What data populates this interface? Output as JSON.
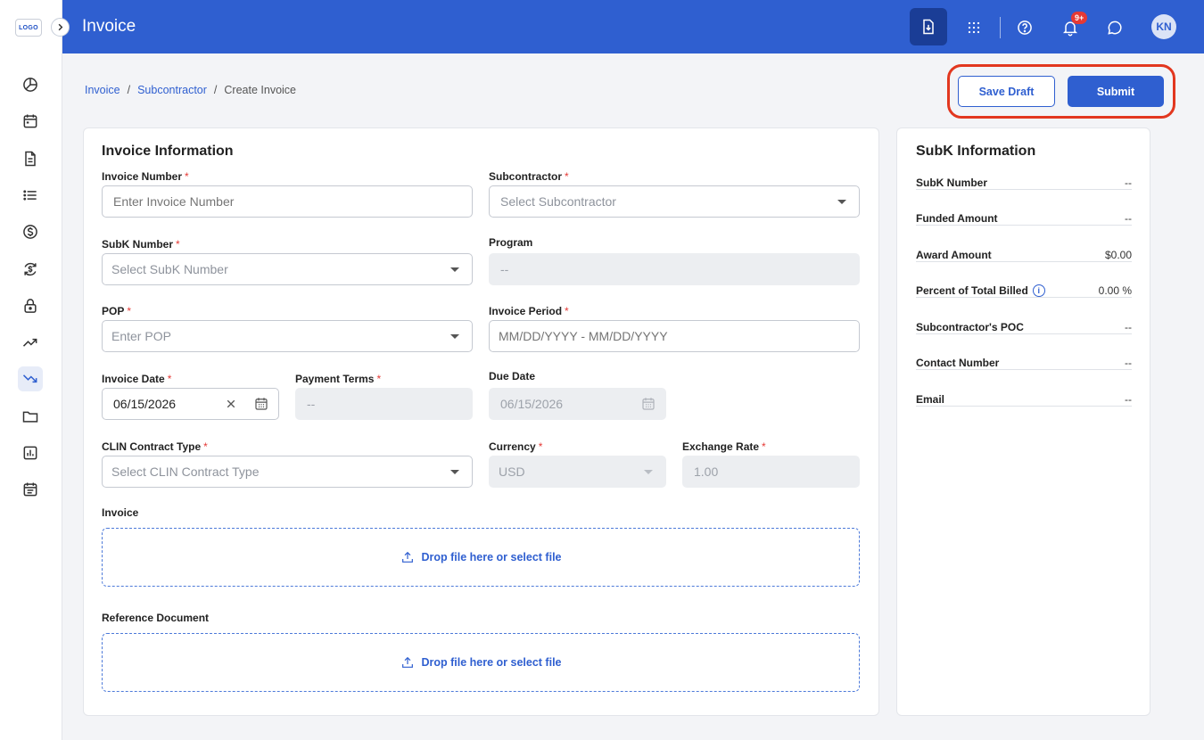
{
  "app": {
    "logo_text": "LOGO",
    "title": "Invoice",
    "notification_count": "9+",
    "avatar_initials": "KN"
  },
  "colors": {
    "primary": "#2f5fd0",
    "primary_dark": "#1a3d96",
    "required": "#e53935",
    "highlight_ring": "#e2371f"
  },
  "sidebar": {
    "items": [
      {
        "icon": "pie-chart-icon"
      },
      {
        "icon": "calendar-icon"
      },
      {
        "icon": "document-icon"
      },
      {
        "icon": "list-icon"
      },
      {
        "icon": "dollar-icon"
      },
      {
        "icon": "refresh-dollar-icon"
      },
      {
        "icon": "lock-icon"
      },
      {
        "icon": "trending-up-icon"
      },
      {
        "icon": "trending-down-icon",
        "active": true
      },
      {
        "icon": "folder-icon"
      },
      {
        "icon": "bar-chart-icon"
      },
      {
        "icon": "calendar-list-icon"
      }
    ]
  },
  "topbar_icons": [
    "download-icon",
    "apps-grid-icon",
    "help-icon",
    "bell-icon",
    "chat-icon"
  ],
  "breadcrumb": {
    "items": [
      "Invoice",
      "Subcontractor",
      "Create Invoice"
    ],
    "separator": "/"
  },
  "actions": {
    "save_draft": "Save Draft",
    "submit": "Submit"
  },
  "form": {
    "title": "Invoice Information",
    "required_mark": "*",
    "invoice_number": {
      "label": "Invoice Number",
      "placeholder": "Enter Invoice Number"
    },
    "subcontractor": {
      "label": "Subcontractor",
      "placeholder": "Select Subcontractor"
    },
    "subk_number": {
      "label": "SubK Number",
      "placeholder": "Select SubK Number"
    },
    "program": {
      "label": "Program",
      "value": "--"
    },
    "pop": {
      "label": "POP",
      "placeholder": "Enter POP"
    },
    "invoice_period": {
      "label": "Invoice Period",
      "placeholder": "MM/DD/YYYY - MM/DD/YYYY"
    },
    "invoice_date": {
      "label": "Invoice Date",
      "value": "06/15/2026"
    },
    "payment_terms": {
      "label": "Payment Terms",
      "value": "--"
    },
    "due_date": {
      "label": "Due Date",
      "value": "06/15/2026"
    },
    "clin_type": {
      "label": "CLIN Contract Type",
      "placeholder": "Select CLIN Contract Type"
    },
    "currency": {
      "label": "Currency",
      "value": "USD"
    },
    "exchange_rate": {
      "label": "Exchange Rate",
      "value": "1.00"
    },
    "invoice_upload": {
      "label": "Invoice",
      "text": "Drop file here or select file"
    },
    "reference_upload": {
      "label": "Reference Document",
      "text": "Drop file here or select file"
    }
  },
  "subk_info": {
    "title": "SubK Information",
    "rows": [
      {
        "key": "SubK Number",
        "value": "--"
      },
      {
        "key": "Funded Amount",
        "value": "--"
      },
      {
        "key": "Award Amount",
        "value": "$0.00"
      },
      {
        "key": "Percent of Total Billed",
        "value": "0.00 %",
        "info_icon": "i"
      },
      {
        "key": "Subcontractor's POC",
        "value": "--"
      },
      {
        "key": "Contact Number",
        "value": "--"
      },
      {
        "key": "Email",
        "value": "--"
      }
    ]
  }
}
